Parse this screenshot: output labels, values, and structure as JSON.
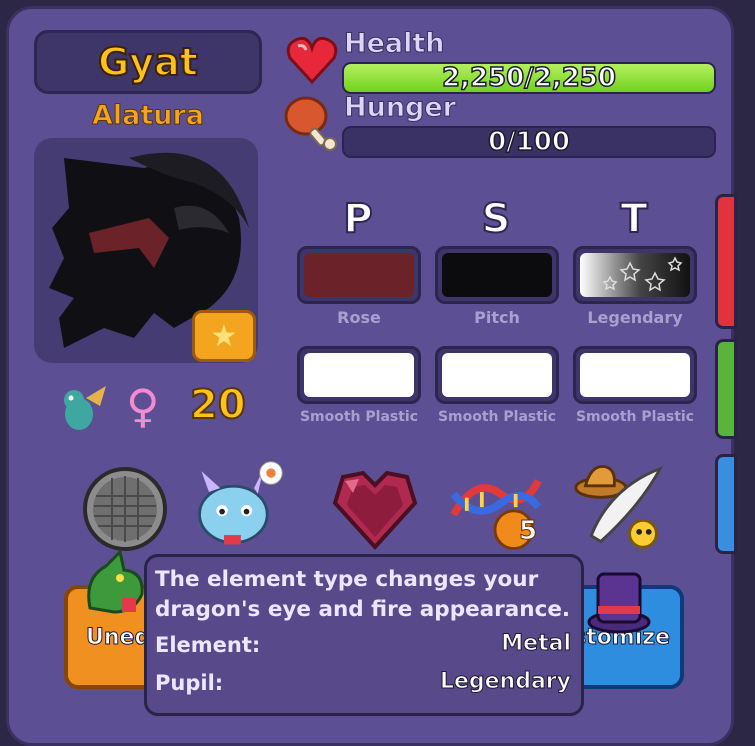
{
  "pet": {
    "name": "Gyat",
    "species": "Alatura",
    "level": "20",
    "gender_icon": "female-symbol-icon"
  },
  "stats": {
    "health": {
      "label": "Health",
      "value": "2,250/2,250",
      "fill_fraction": 1.0
    },
    "hunger": {
      "label": "Hunger",
      "value": "0/100",
      "fill_fraction": 0.0
    }
  },
  "colors": {
    "headers": [
      "P",
      "S",
      "T"
    ],
    "primary_row": [
      {
        "label": "Rose",
        "hex": "#6b2228"
      },
      {
        "label": "Pitch",
        "hex": "#0c0c0e"
      },
      {
        "label": "Legendary",
        "hex": "#222222"
      }
    ],
    "material_row": [
      {
        "label": "Smooth Plastic",
        "hex": "#ffffff"
      },
      {
        "label": "Smooth Plastic",
        "hex": "#ffffff"
      },
      {
        "label": "Smooth Plastic",
        "hex": "#ffffff"
      }
    ]
  },
  "action_buttons": {
    "dna_count": "5"
  },
  "bottom_buttons": {
    "unequip": "Uneq",
    "customize": "stomize"
  },
  "tooltip": {
    "description": "The element type changes your dragon's eye and fire appearance.",
    "element_label": "Element:",
    "element_value": "Metal",
    "pupil_label": "Pupil:",
    "pupil_value": "Legendary"
  },
  "accent_colors": {
    "health_fill": "#8fe03a",
    "name_gold": "#ffc21a",
    "panel": "#5d4f94"
  }
}
